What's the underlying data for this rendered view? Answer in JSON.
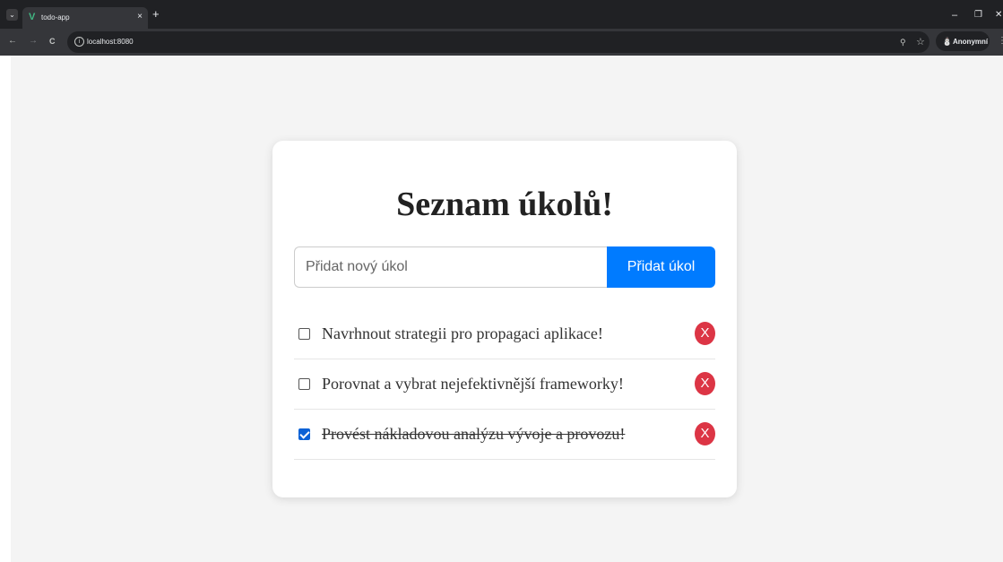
{
  "browser": {
    "tab": {
      "title": "todo-app",
      "favicon": "vue-logo-icon",
      "close": "×",
      "new_tab": "+"
    },
    "tab_menu": "⌄",
    "window": {
      "minimize": "–",
      "restore": "❐",
      "close": "✕"
    },
    "nav": {
      "back": "←",
      "forward": "→",
      "reload": "C"
    },
    "url": "localhost:8080",
    "site_info": "i",
    "zoom": "⚲",
    "bookmark": "☆",
    "profile": {
      "icon": "incognito-icon",
      "label": "Anonymní"
    },
    "menu": "⋮"
  },
  "app": {
    "title": "Seznam úkolů!",
    "input": {
      "placeholder": "Přidat nový úkol",
      "value": ""
    },
    "add_button": "Přidat úkol",
    "tasks": [
      {
        "text": "Navrhnout strategii pro propagaci aplikace!",
        "done": false,
        "delete_label": "X"
      },
      {
        "text": "Porovnat a vybrat nejefektivnější frameworky!",
        "done": false,
        "delete_label": "X"
      },
      {
        "text": "Provést nákladovou analýzu vývoje a provozu!",
        "done": true,
        "delete_label": "X"
      }
    ]
  },
  "colors": {
    "accent": "#007bff",
    "delete": "#dc3545",
    "checkbox_checked": "#0b62d6",
    "page_background": "#f4f4f4"
  }
}
